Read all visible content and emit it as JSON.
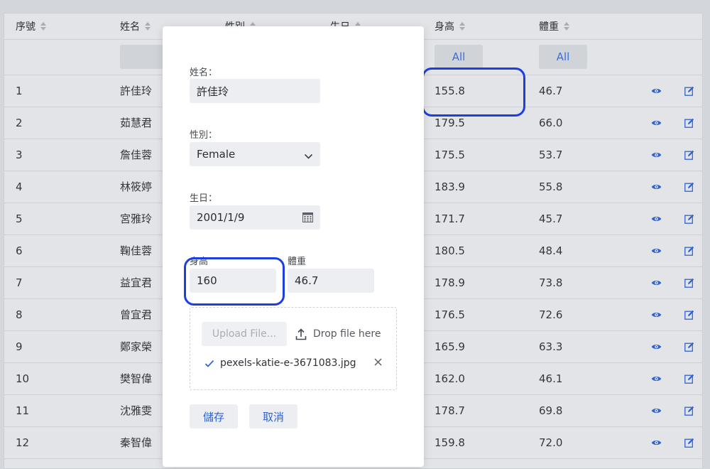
{
  "table": {
    "headers": [
      {
        "label": "序號"
      },
      {
        "label": "姓名"
      },
      {
        "label": "性別"
      },
      {
        "label": "生日"
      },
      {
        "label": "身高"
      },
      {
        "label": "體重"
      }
    ],
    "filters": {
      "height": "All",
      "weight": "All"
    },
    "rows": [
      {
        "id": "1",
        "name": "許佳玲",
        "height": "155.8",
        "weight": "46.7"
      },
      {
        "id": "2",
        "name": "茹慧君",
        "height": "179.5",
        "weight": "66.0"
      },
      {
        "id": "3",
        "name": "詹佳蓉",
        "height": "175.5",
        "weight": "53.7"
      },
      {
        "id": "4",
        "name": "林筱婷",
        "height": "183.9",
        "weight": "55.8"
      },
      {
        "id": "5",
        "name": "宮雅玲",
        "height": "171.7",
        "weight": "45.7"
      },
      {
        "id": "6",
        "name": "鞠佳蓉",
        "height": "180.5",
        "weight": "48.4"
      },
      {
        "id": "7",
        "name": "益宜君",
        "height": "178.9",
        "weight": "73.8"
      },
      {
        "id": "8",
        "name": "曾宜君",
        "height": "176.5",
        "weight": "72.6"
      },
      {
        "id": "9",
        "name": "鄭家榮",
        "height": "165.9",
        "weight": "63.3"
      },
      {
        "id": "10",
        "name": "樊智偉",
        "height": "162.0",
        "weight": "46.1"
      },
      {
        "id": "11",
        "name": "沈雅雯",
        "height": "178.7",
        "weight": "69.8"
      },
      {
        "id": "12",
        "name": "秦智偉",
        "height": "159.8",
        "weight": "72.0"
      }
    ]
  },
  "form": {
    "name_label": "姓名：",
    "name_value": "許佳玲",
    "gender_label": "性別：",
    "gender_value": "Female",
    "birthday_label": "生日：",
    "birthday_value": "2001/1/9",
    "height_label": "身高",
    "height_value": "160",
    "weight_label": "體重",
    "weight_value": "46.7",
    "upload_button": "Upload File...",
    "drop_text": "Drop file here",
    "file_name": "pexels-katie-e-3671083.jpg",
    "save_button": "儲存",
    "cancel_button": "取消"
  },
  "colors": {
    "accent": "#3a6fd8",
    "highlight": "#1b3fe0"
  },
  "icons": {
    "row_view": "eye-icon",
    "row_edit": "edit-icon",
    "sort": "sort-icon",
    "gender_dropdown": "chevron-down-icon",
    "birthday_picker": "calendar-icon",
    "upload": "upload-icon",
    "file_status": "check-icon",
    "file_remove": "close-icon"
  }
}
